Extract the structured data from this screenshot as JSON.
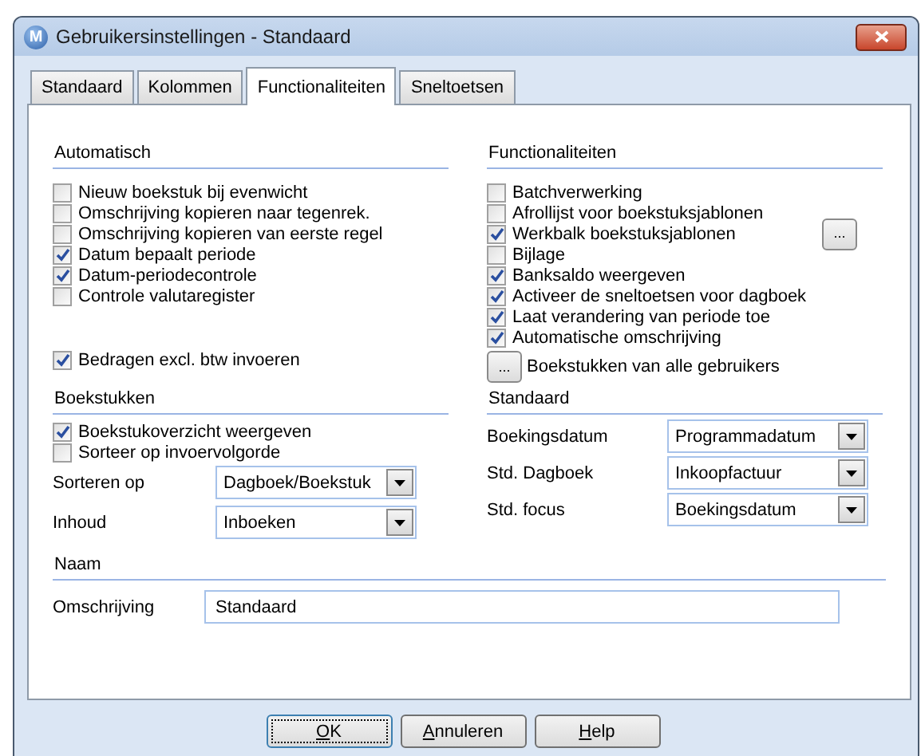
{
  "window": {
    "title": "Gebruikersinstellingen - Standaard",
    "logo": "M"
  },
  "tabs": [
    {
      "label": "Standaard",
      "selected": false
    },
    {
      "label": "Kolommen",
      "selected": false
    },
    {
      "label": "Functionaliteiten",
      "selected": true
    },
    {
      "label": "Sneltoetsen",
      "selected": false
    }
  ],
  "automatisch": {
    "title": "Automatisch",
    "options": [
      {
        "label": "Nieuw boekstuk bij evenwicht",
        "checked": false
      },
      {
        "label": "Omschrijving kopieren naar tegenrek.",
        "checked": false
      },
      {
        "label": "Omschrijving kopieren van eerste regel",
        "checked": false
      },
      {
        "label": "Datum bepaalt periode",
        "checked": true
      },
      {
        "label": "Datum-periodecontrole",
        "checked": true
      },
      {
        "label": "Controle valutaregister",
        "checked": false
      }
    ],
    "extra_options": [
      {
        "label": "Bedragen excl. btw invoeren",
        "checked": true
      }
    ]
  },
  "functionaliteiten": {
    "title": "Functionaliteiten",
    "options": [
      {
        "label": "Batchverwerking",
        "checked": false
      },
      {
        "label": "Afrollijst voor boekstuksjablonen",
        "checked": false
      },
      {
        "label": "Werkbalk boekstuksjablonen",
        "checked": true,
        "button": "..."
      },
      {
        "label": "Bijlage",
        "checked": false
      },
      {
        "label": "Banksaldo weergeven",
        "checked": true
      },
      {
        "label": "Activeer de sneltoetsen voor dagboek",
        "checked": true
      },
      {
        "label": "Laat verandering van periode toe",
        "checked": true
      },
      {
        "label": "Automatische omschrijving",
        "checked": true
      }
    ],
    "users_button": {
      "button": "...",
      "label": "Boekstukken van alle gebruikers"
    }
  },
  "boekstukken": {
    "title": "Boekstukken",
    "options": [
      {
        "label": "Boekstukoverzicht weergeven",
        "checked": true
      },
      {
        "label": "Sorteer op invoervolgorde",
        "checked": false
      }
    ],
    "fields": [
      {
        "label": "Sorteren op",
        "value": "Dagboek/Boekstuk"
      },
      {
        "label": "Inhoud",
        "value": "Inboeken"
      }
    ]
  },
  "standaard": {
    "title": "Standaard",
    "fields": [
      {
        "label": "Boekingsdatum",
        "value": "Programmadatum"
      },
      {
        "label": "Std. Dagboek",
        "value": "Inkoopfactuur"
      },
      {
        "label": "Std. focus",
        "value": "Boekingsdatum"
      }
    ]
  },
  "naam": {
    "title": "Naam",
    "field": {
      "label": "Omschrijving",
      "value": "Standaard"
    }
  },
  "buttons": [
    {
      "accel": "O",
      "rest": "K",
      "default": true
    },
    {
      "accel": "A",
      "rest": "nnuleren",
      "default": false
    },
    {
      "accel": "H",
      "rest": "elp",
      "default": false
    }
  ]
}
